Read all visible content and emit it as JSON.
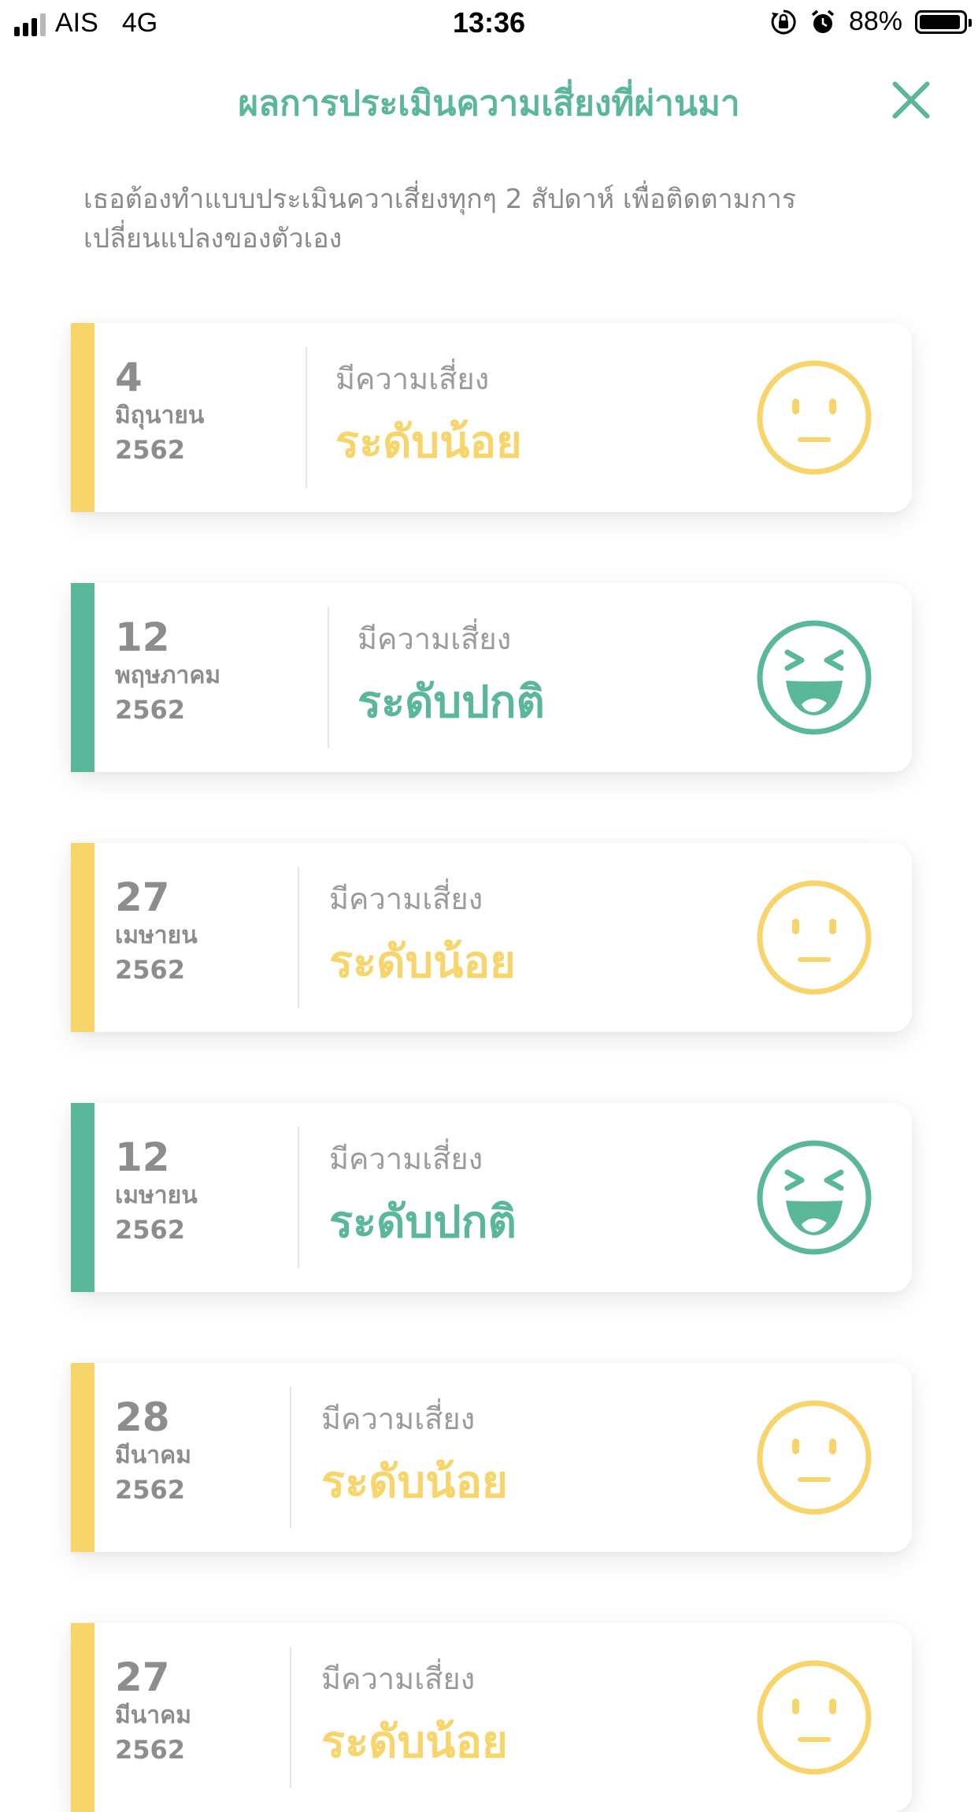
{
  "status_bar": {
    "carrier": "AIS",
    "network": "4G",
    "time": "13:36",
    "battery": "88%",
    "battery_level": 0.88,
    "icons": [
      "rotation-lock-icon",
      "alarm-icon"
    ]
  },
  "header": {
    "title": "ผลการประเมินความเสี่ยงที่ผ่านมา",
    "close_icon": "close-icon"
  },
  "description": "เธอต้องทำแบบประเมินควาเสี่ยงทุกๆ 2 สัปดาห์ เพื่อติดตามการเปลี่ยนแปลงของตัวเอง",
  "colors": {
    "accent_green": "#5bb799",
    "low_yellow": "#f7d56b",
    "text_gray": "#8d8d8d"
  },
  "assessments": [
    {
      "day": "4",
      "month": "มิถุนายน",
      "year": "2562",
      "risk_label": "มีความเสี่ยง",
      "level": "ระดับน้อย",
      "status": "low",
      "face_icon": "neutral-face-icon"
    },
    {
      "day": "12",
      "month": "พฤษภาคม",
      "year": "2562",
      "risk_label": "มีความเสี่ยง",
      "level": "ระดับปกติ",
      "status": "normal",
      "face_icon": "laughing-face-icon"
    },
    {
      "day": "27",
      "month": "เมษายน",
      "year": "2562",
      "risk_label": "มีความเสี่ยง",
      "level": "ระดับน้อย",
      "status": "low",
      "face_icon": "neutral-face-icon"
    },
    {
      "day": "12",
      "month": "เมษายน",
      "year": "2562",
      "risk_label": "มีความเสี่ยง",
      "level": "ระดับปกติ",
      "status": "normal",
      "face_icon": "laughing-face-icon"
    },
    {
      "day": "28",
      "month": "มีนาคม",
      "year": "2562",
      "risk_label": "มีความเสี่ยง",
      "level": "ระดับน้อย",
      "status": "low",
      "face_icon": "neutral-face-icon"
    },
    {
      "day": "27",
      "month": "มีนาคม",
      "year": "2562",
      "risk_label": "มีความเสี่ยง",
      "level": "ระดับน้อย",
      "status": "low",
      "face_icon": "neutral-face-icon"
    }
  ]
}
